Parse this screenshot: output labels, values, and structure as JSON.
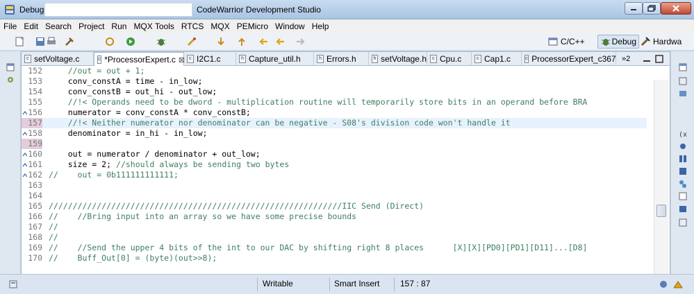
{
  "window": {
    "title_prefix": "Debug -",
    "studio_title": "CodeWarrior Development Studio",
    "icon": "workbench-icon"
  },
  "menu": [
    "File",
    "Edit",
    "Search",
    "Project",
    "Run",
    "MQX Tools",
    "RTCS",
    "MQX",
    "PEMicro",
    "Window",
    "Help"
  ],
  "perspectives": {
    "cpp": "C/C++",
    "debug": "Debug",
    "hardware": "Hardwa"
  },
  "tabs": [
    {
      "label": "setVoltage.c"
    },
    {
      "label": "*ProcessorExpert.c",
      "active": true,
      "close": "⊠"
    },
    {
      "label": "I2C1.c"
    },
    {
      "label": "Capture_util.h"
    },
    {
      "label": "Errors.h"
    },
    {
      "label": "setVoltage.h"
    },
    {
      "label": "Cpu.c"
    },
    {
      "label": "Cap1.c"
    },
    {
      "label": "ProcessorExpert_c367"
    }
  ],
  "overflow_tabs": "»2",
  "code": {
    "lines": [
      {
        "num": "152",
        "text": "    //out = out + 1;",
        "kind": "comment"
      },
      {
        "num": "153",
        "text": "    conv_constA = time - in_low;",
        "kind": "code"
      },
      {
        "num": "154",
        "text": "    conv_constB = out_hi - out_low;",
        "kind": "code"
      },
      {
        "num": "155",
        "text": "    //!< Operands need to be dword - multiplication routine will temporarily store bits in an operand before BRA",
        "kind": "comment"
      },
      {
        "num": "156",
        "text": "    numerator = conv_constA * conv_constB;",
        "kind": "code",
        "marker": true
      },
      {
        "num": "157",
        "text": "    //!< Neither numerator nor denominator can be negative - S08's division code won't handle it",
        "kind": "comment",
        "current": true
      },
      {
        "num": "158",
        "text": "    denominator = in_hi - in_low;",
        "kind": "code",
        "marker": true
      },
      {
        "num": "159",
        "text": "",
        "kind": "code",
        "highlight": true
      },
      {
        "num": "160",
        "text": "    out = numerator / denominator + out_low;",
        "kind": "code",
        "marker": true
      },
      {
        "num": "161",
        "text": "    size = 2; ",
        "kind": "code",
        "marker": true,
        "tail": "//should always be sending two bytes"
      },
      {
        "num": "162",
        "text": "//    out = 0b111111111111;",
        "kind": "mixed",
        "marker": true
      },
      {
        "num": "163",
        "text": "",
        "kind": "code"
      },
      {
        "num": "164",
        "text": "",
        "kind": "code"
      },
      {
        "num": "165",
        "text": "/////////////////////////////////////////////////////////////IIC Send (Direct)",
        "kind": "comment"
      },
      {
        "num": "166",
        "text": "//    //Bring input into an array so we have some precise bounds",
        "kind": "comment"
      },
      {
        "num": "167",
        "text": "//",
        "kind": "comment"
      },
      {
        "num": "168",
        "text": "//",
        "kind": "comment"
      },
      {
        "num": "169",
        "text": "//    //Send the upper 4 bits of the int to our DAC by shifting right 8 places      [X][X][PD0][PD1][D11]...[D8]",
        "kind": "comment"
      },
      {
        "num": "170",
        "text": "//    Buff_Out[0] = (byte)(out>>8);",
        "kind": "comment"
      }
    ]
  },
  "status": {
    "writable": "Writable",
    "insert_mode": "Smart Insert",
    "position": "157 : 87"
  },
  "colors": {
    "comment": "#3f7f5f",
    "current_line": "#e8f2fe",
    "line_number": "#787878"
  }
}
